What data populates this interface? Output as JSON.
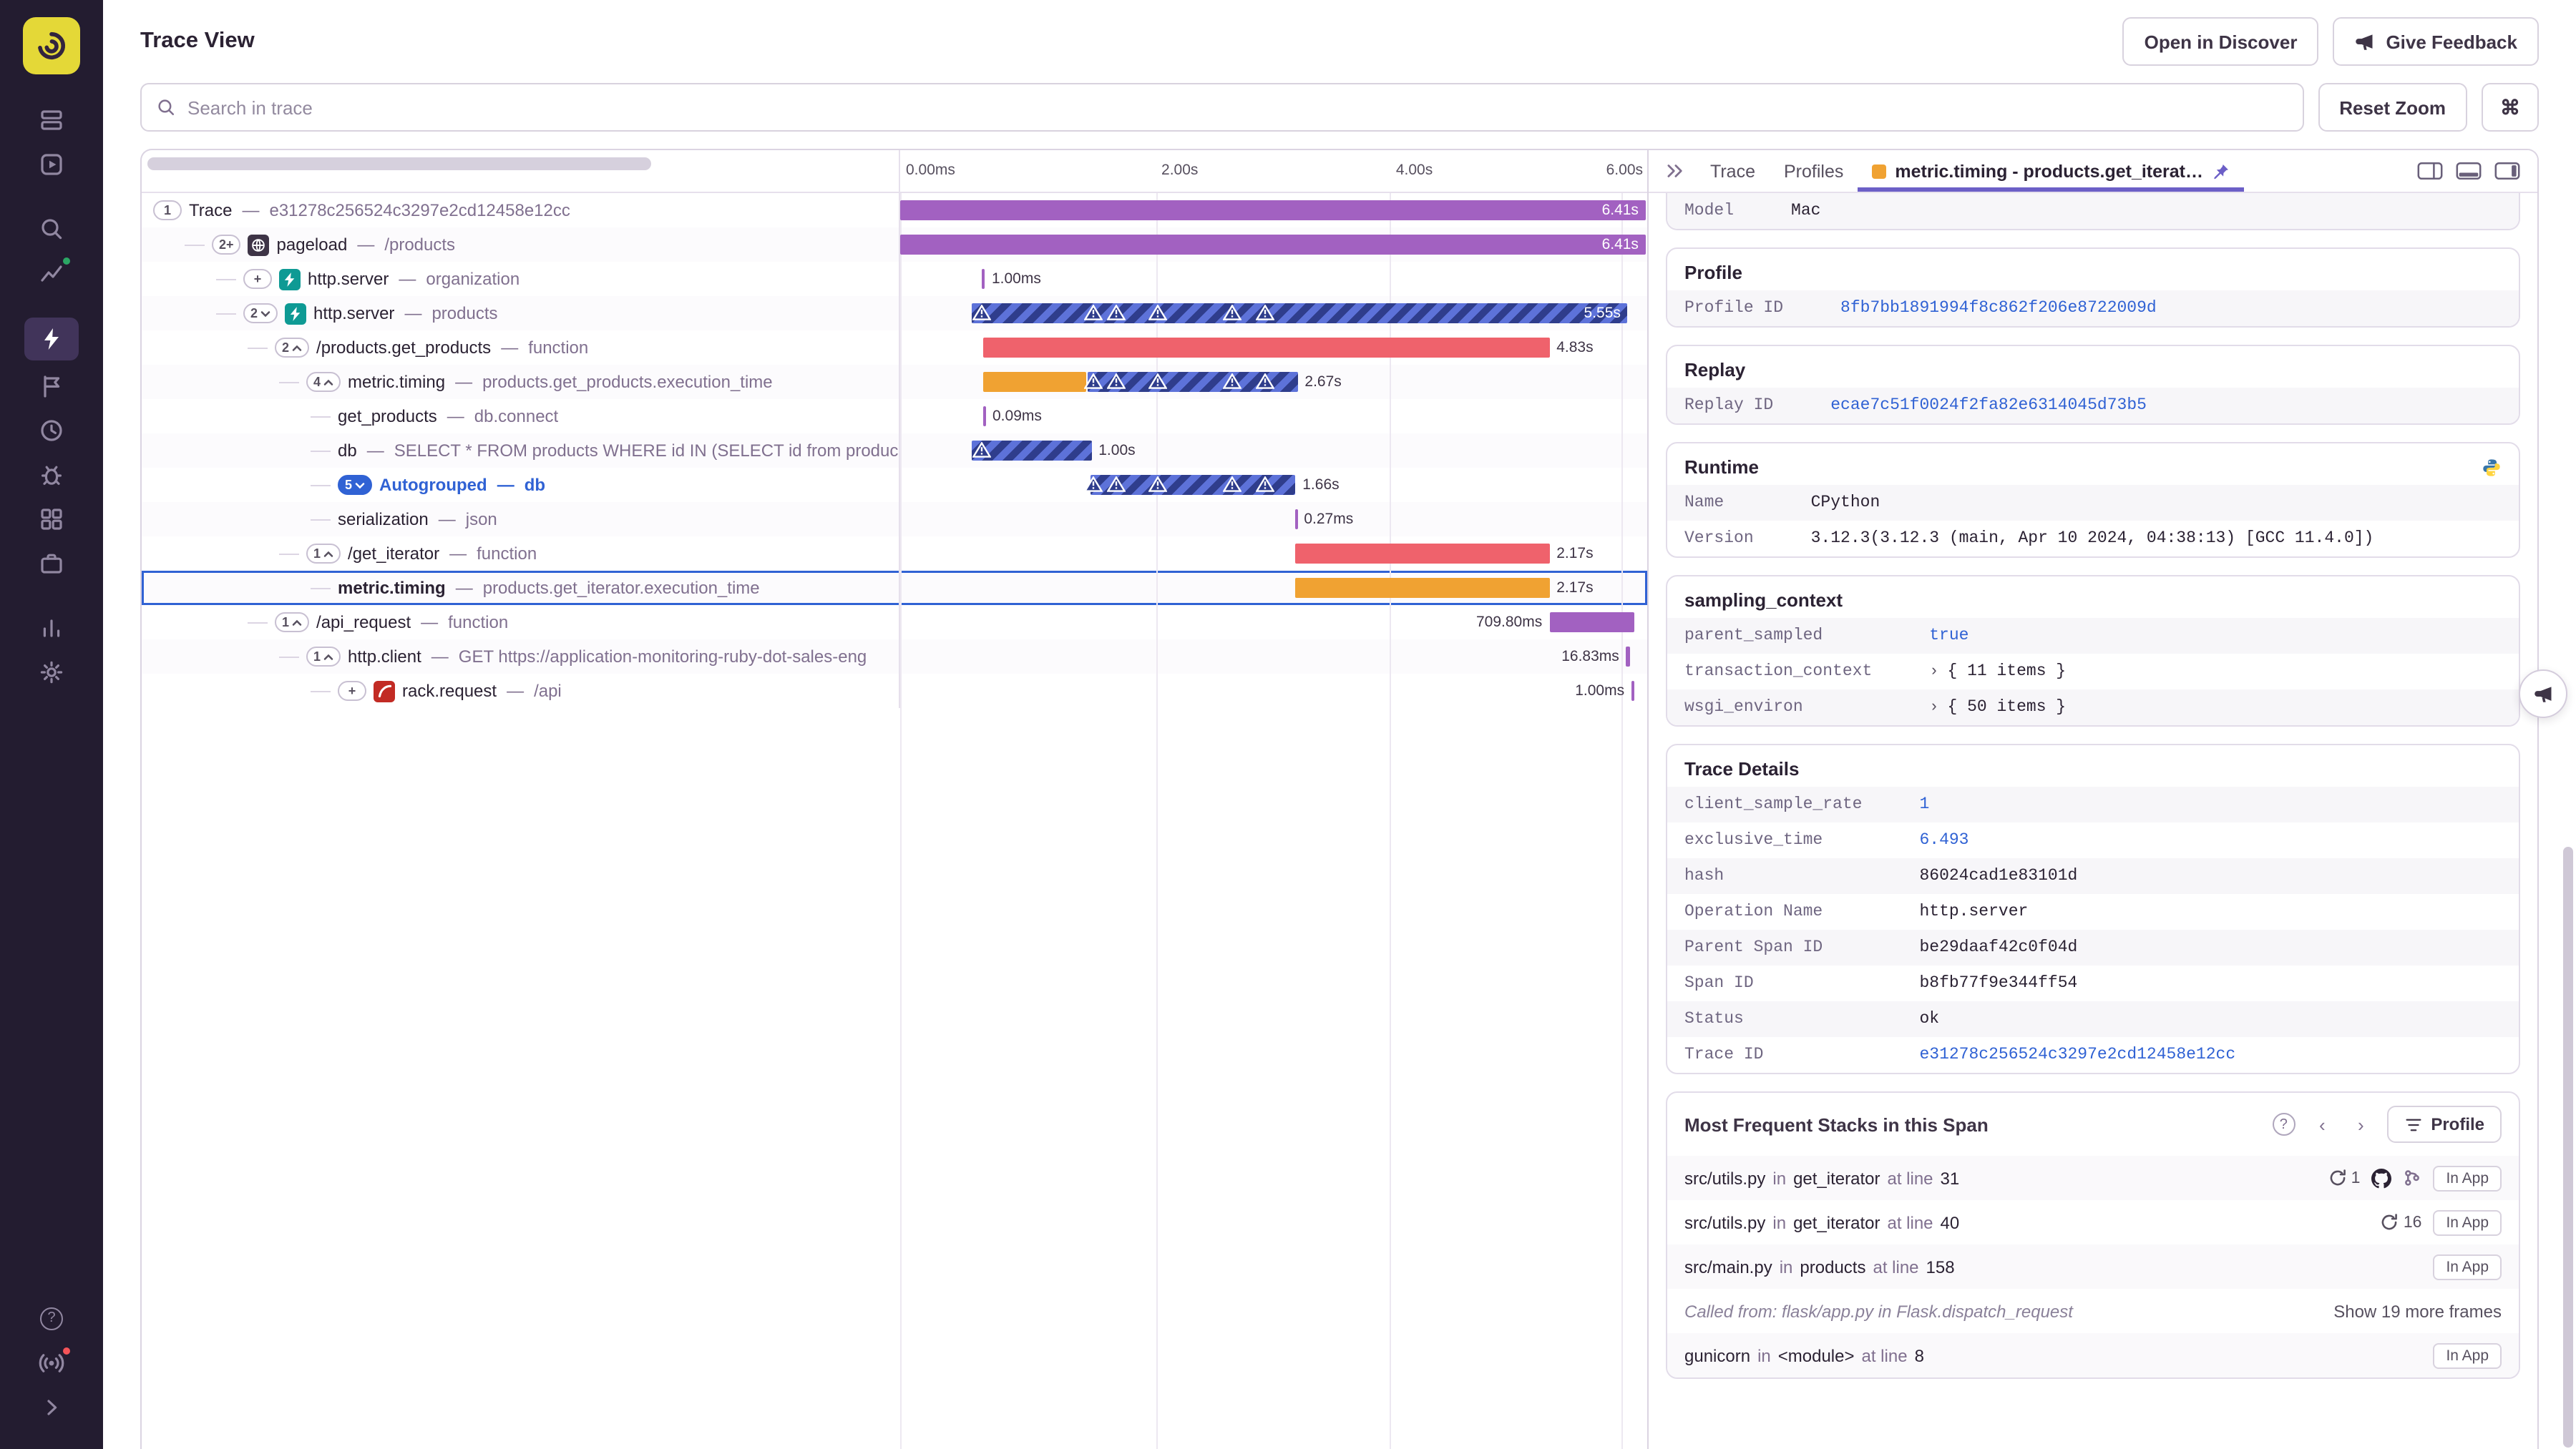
{
  "header": {
    "title": "Trace View",
    "open_in_discover": "Open in Discover",
    "give_feedback": "Give Feedback"
  },
  "toolbar": {
    "search_placeholder": "Search in trace",
    "reset_zoom_label": "Reset Zoom",
    "shortcut_glyph": "⌘"
  },
  "glyphs": {
    "help": "?",
    "expand": "»",
    "chev_left": "‹",
    "chev_right": "›",
    "kv_expand": "›"
  },
  "palette": {
    "purple": "#A261C1",
    "red": "#EF626C",
    "orange": "#F0A232",
    "stripe_a": "#5D72D9",
    "stripe_b": "#2F3D8C",
    "link": "#3062D4",
    "tab_accent": "#6C5FC7",
    "green_dot": "#2BA664",
    "red_dot": "#F55459"
  },
  "sidebar": {
    "items": [
      {
        "name": "issues"
      },
      {
        "name": "explore"
      },
      {
        "name": "search",
        "gap": true
      },
      {
        "name": "metrics",
        "dot": "#2BA664"
      },
      {
        "name": "profiling",
        "active": true,
        "gap": true
      },
      {
        "name": "releases"
      },
      {
        "name": "crons"
      },
      {
        "name": "insights"
      },
      {
        "name": "stats"
      },
      {
        "name": "projects"
      },
      {
        "name": "dashboards",
        "gap": true
      },
      {
        "name": "settings"
      }
    ],
    "bottom": [
      {
        "name": "help"
      },
      {
        "name": "whats-new",
        "dot": "#F55459"
      },
      {
        "name": "collapse"
      }
    ]
  },
  "waterfall": {
    "axis": [
      {
        "label": "0.00ms",
        "pct": 0
      },
      {
        "label": "2.00s",
        "pct": 34.2
      },
      {
        "label": "4.00s",
        "pct": 65.6
      },
      {
        "label": "6.00s",
        "pct": 96.5,
        "align": "right"
      }
    ]
  },
  "trace": {
    "sep": "—",
    "rows": [
      {
        "depth": 0,
        "badge": {
          "text": "1"
        },
        "op": "Trace",
        "desc": "e31278c256524c3297e2cd12458e12cc",
        "segments": [
          {
            "color": "purple",
            "left": 0,
            "width": 99.8
          }
        ],
        "label": {
          "text": "6.41s",
          "pos": "inside"
        }
      },
      {
        "depth": 1,
        "badge": {
          "text": "2+"
        },
        "icon": "browser",
        "op": "pageload",
        "desc": "/products",
        "segments": [
          {
            "color": "purple",
            "left": 0,
            "width": 99.8
          }
        ],
        "label": {
          "text": "6.41s",
          "pos": "inside"
        }
      },
      {
        "depth": 2,
        "badge": {
          "text": "+"
        },
        "icon": "server",
        "op": "http.server",
        "desc": "organization",
        "segments": [
          {
            "color": "purple",
            "left": 11.0,
            "width": 0.3
          }
        ],
        "label": {
          "text": "1.00ms",
          "pos": "after"
        }
      },
      {
        "depth": 2,
        "badge": {
          "text": "2",
          "chev": "down"
        },
        "icon": "server",
        "op": "http.server",
        "desc": "products",
        "segments": [
          {
            "striped": true,
            "left": 9.6,
            "width": 87.8
          }
        ],
        "triangles": [
          10.9,
          25.9,
          28.9,
          34.4,
          44.4,
          48.9
        ],
        "label": {
          "text": "5.55s",
          "pos": "inside"
        }
      },
      {
        "depth": 3,
        "badge": {
          "text": "2",
          "chev": "up"
        },
        "op": "/products.get_products",
        "desc": "function",
        "segments": [
          {
            "color": "red",
            "left": 11.2,
            "width": 75.7
          }
        ],
        "label": {
          "text": "4.83s",
          "pos": "after"
        }
      },
      {
        "depth": 4,
        "badge": {
          "text": "4",
          "chev": "up"
        },
        "op": "metric.timing",
        "desc": "products.get_products.execution_time",
        "segments": [
          {
            "color": "orange",
            "left": 11.2,
            "width": 13.8
          },
          {
            "striped": true,
            "left": 25.0,
            "width": 28.2
          }
        ],
        "triangles": [
          25.9,
          28.9,
          34.4,
          44.4,
          48.9
        ],
        "label": {
          "text": "2.67s",
          "pos": "after"
        }
      },
      {
        "depth": 5,
        "op": "get_products",
        "desc": "db.connect",
        "segments": [
          {
            "color": "purple",
            "left": 11.2,
            "width": 0.2
          }
        ],
        "label": {
          "text": "0.09ms",
          "pos": "after"
        }
      },
      {
        "depth": 5,
        "op": "db",
        "desc": "SELECT * FROM products WHERE id IN (SELECT id from produc",
        "segments": [
          {
            "striped": true,
            "left": 9.6,
            "width": 16.0
          }
        ],
        "triangles": [
          10.9
        ],
        "label": {
          "text": "1.00s",
          "pos": "after"
        }
      },
      {
        "depth": 5,
        "badge": {
          "text": "5",
          "chev": "down",
          "blue": true
        },
        "op": "Autogrouped",
        "desc": "db",
        "blue": true,
        "segments": [
          {
            "striped": true,
            "left": 25.4,
            "width": 27.5
          }
        ],
        "triangles": [
          25.9,
          28.9,
          34.4,
          44.4,
          48.9
        ],
        "label": {
          "text": "1.66s",
          "pos": "after"
        }
      },
      {
        "depth": 5,
        "op": "serialization",
        "desc": "json",
        "segments": [
          {
            "color": "purple",
            "left": 52.9,
            "width": 0.2
          }
        ],
        "label": {
          "text": "0.27ms",
          "pos": "after"
        }
      },
      {
        "depth": 4,
        "badge": {
          "text": "1",
          "chev": "up"
        },
        "op": "/get_iterator",
        "desc": "function",
        "segments": [
          {
            "color": "red",
            "left": 52.9,
            "width": 34.0
          }
        ],
        "label": {
          "text": "2.17s",
          "pos": "after"
        }
      },
      {
        "depth": 5,
        "op": "metric.timing",
        "desc": "products.get_iterator.execution_time",
        "selected": true,
        "segments": [
          {
            "color": "orange",
            "left": 52.9,
            "width": 34.0
          }
        ],
        "label": {
          "text": "2.17s",
          "pos": "after"
        }
      },
      {
        "depth": 3,
        "badge": {
          "text": "1",
          "chev": "up"
        },
        "op": "/api_request",
        "desc": "function",
        "segments": [
          {
            "color": "purple",
            "left": 86.9,
            "width": 11.3
          }
        ],
        "label": {
          "text": "709.80ms",
          "pos": "before"
        }
      },
      {
        "depth": 4,
        "badge": {
          "text": "1",
          "chev": "up"
        },
        "op": "http.client",
        "desc": "GET https://application-monitoring-ruby-dot-sales-eng",
        "segments": [
          {
            "color": "purple",
            "left": 97.2,
            "width": 0.5
          }
        ],
        "label": {
          "text": "16.83ms",
          "pos": "before"
        }
      },
      {
        "depth": 5,
        "badge": {
          "text": "+"
        },
        "icon": "rails",
        "op": "rack.request",
        "desc": "/api",
        "segments": [
          {
            "color": "purple",
            "left": 97.9,
            "width": 0.3
          }
        ],
        "label": {
          "text": "1.00ms",
          "pos": "before"
        }
      }
    ]
  },
  "tabs": {
    "items": [
      {
        "label": "Trace"
      },
      {
        "label": "Profiles"
      },
      {
        "label": "metric.timing - products.get_iterat…",
        "active": true,
        "swatch": "#F0A232",
        "pinned": true
      }
    ]
  },
  "details": {
    "sections": [
      {
        "partial": true,
        "rows": [
          {
            "key": "Model",
            "value": "Mac"
          }
        ]
      },
      {
        "title": "Profile",
        "rows": [
          {
            "key": "Profile ID",
            "value": "8fb7bb1891994f8c862f206e8722009d",
            "style": "link"
          }
        ]
      },
      {
        "title": "Replay",
        "rows": [
          {
            "key": "Replay ID",
            "value": "ecae7c51f0024f2fa82e6314045d73b5",
            "style": "link"
          }
        ]
      },
      {
        "title": "Runtime",
        "title_icon": "python",
        "rows": [
          {
            "key": "Name",
            "value": "CPython"
          },
          {
            "key": "Version",
            "value": "3.12.3(3.12.3 (main, Apr 10 2024, 04:38:13) [GCC 11.4.0])"
          }
        ]
      },
      {
        "title": "sampling_context",
        "rows": [
          {
            "key": "parent_sampled",
            "value": "true",
            "style": "link"
          },
          {
            "key": "transaction_context",
            "value": "{ 11 items }",
            "expandable": true
          },
          {
            "key": "wsgi_environ",
            "value": "{ 50 items }",
            "expandable": true
          }
        ]
      },
      {
        "title": "Trace Details",
        "rows": [
          {
            "key": "client_sample_rate",
            "value": "1",
            "style": "link"
          },
          {
            "key": "exclusive_time",
            "value": "6.493",
            "style": "link"
          },
          {
            "key": "hash",
            "value": "86024cad1e83101d"
          },
          {
            "key": "Operation Name",
            "value": "http.server"
          },
          {
            "key": "Parent Span ID",
            "value": "be29daaf42c0f04d"
          },
          {
            "key": "Span ID",
            "value": "b8fb77f9e344ff54"
          },
          {
            "key": "Status",
            "value": "ok"
          },
          {
            "key": "Trace ID",
            "value": "e31278c256524c3297e2cd12458e12cc",
            "style": "link"
          }
        ]
      }
    ]
  },
  "stacks": {
    "title": "Most Frequent Stacks in this Span",
    "profile_button": "Profile",
    "labels": {
      "in": "in",
      "at_line": "at line"
    },
    "frames": [
      {
        "file": "src/utils.py",
        "func": "get_iterator",
        "line": "31",
        "count": "1",
        "icons": [
          "github",
          "branch"
        ],
        "badge": "In App"
      },
      {
        "file": "src/utils.py",
        "func": "get_iterator",
        "line": "40",
        "count": "16",
        "badge": "In App"
      },
      {
        "file": "src/main.py",
        "func": "products",
        "line": "158",
        "badge": "In App"
      },
      {
        "called_from": "Called from: flask/app.py in Flask.dispatch_request",
        "more_label": "Show 19 more frames"
      },
      {
        "file": "gunicorn",
        "func": "<module>",
        "line": "8",
        "badge": "In App"
      }
    ]
  }
}
